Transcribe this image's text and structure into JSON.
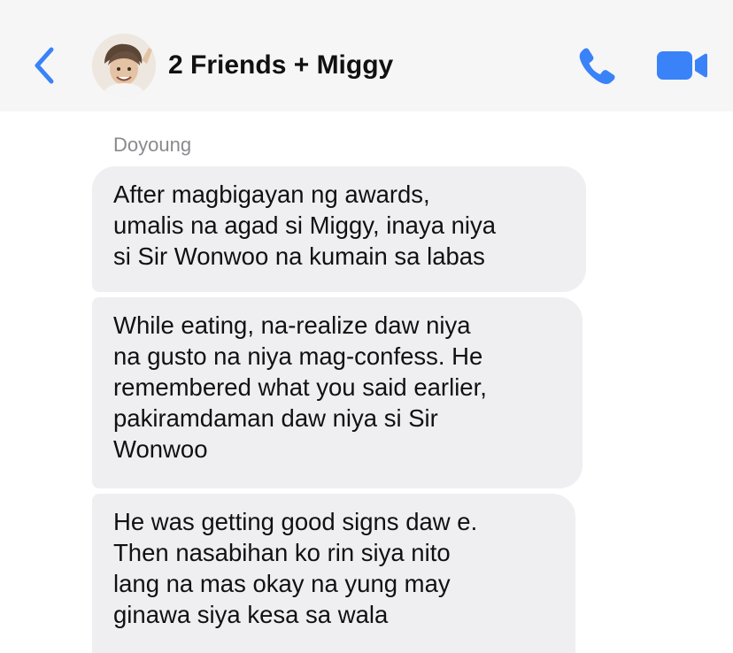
{
  "header": {
    "title": "2 Friends + Miggy",
    "accent_color": "#3a82f7",
    "icons": [
      "chevron-left-icon",
      "avatar",
      "phone-icon",
      "video-camera-icon"
    ]
  },
  "messages": {
    "sender": "Doyoung",
    "items": [
      {
        "text": "After magbigayan ng awards,\numalis na agad si Miggy, inaya niya\nsi Sir Wonwoo na kumain sa labas"
      },
      {
        "text": "While eating, na-realize daw niya\nna gusto na niya mag-confess. He\nremembered what you said earlier,\npakiramdaman daw niya si Sir\nWonwoo"
      },
      {
        "text": "He was getting good signs daw e.\nThen nasabihan ko rin siya nito\nlang na mas okay na yung may\nginawa siya kesa sa wala"
      }
    ]
  }
}
